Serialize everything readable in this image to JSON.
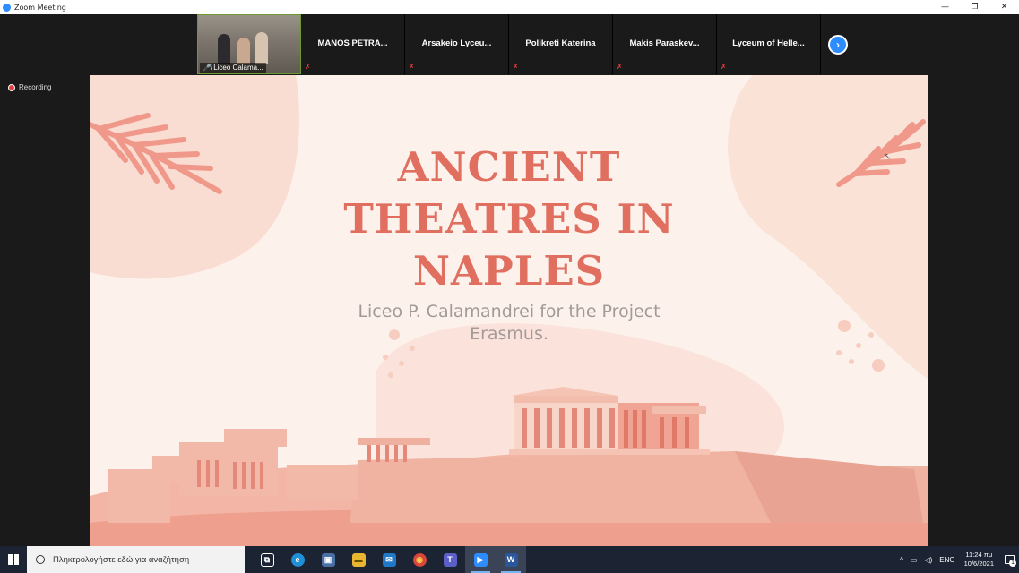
{
  "window": {
    "title": "Zoom Meeting",
    "controls": {
      "minimize": "—",
      "restore": "❐",
      "close": "✕"
    }
  },
  "participants": [
    {
      "name": "Liceo Calama...",
      "video": true,
      "muted": true
    },
    {
      "name": "MANOS  PETRA...",
      "video": false,
      "muted": true
    },
    {
      "name": "Arsakeio  Lyceu...",
      "video": false,
      "muted": true
    },
    {
      "name": "Polikreti Katerina",
      "video": false,
      "muted": true
    },
    {
      "name": "Makis  Paraskev...",
      "video": false,
      "muted": true
    },
    {
      "name": "Lyceum  of  Helle...",
      "video": false,
      "muted": true
    }
  ],
  "next_page_icon": "chevron-right-icon",
  "recording": {
    "label": "Recording"
  },
  "slide": {
    "title_lines": [
      "ANCIENT",
      "THEATRES IN",
      "NAPLES"
    ],
    "subtitle_lines": [
      "Liceo P. Calamandrei for the Project",
      "Erasmus."
    ],
    "colors": {
      "background": "#fdf1ec",
      "title": "#e06f60",
      "subtitle": "#a29a98",
      "accent": "#f0a08e"
    }
  },
  "taskbar": {
    "search_placeholder": "Πληκτρολογήστε εδώ για αναζήτηση",
    "apps": [
      {
        "icon": "task-view-icon",
        "label": "⧉",
        "color": "transparent"
      },
      {
        "icon": "edge-icon",
        "label": "e",
        "color": "#1f8fd6"
      },
      {
        "icon": "store-icon",
        "label": "▣",
        "color": "#4a6fa5"
      },
      {
        "icon": "file-explorer-icon",
        "label": "▬",
        "color": "#e8b630"
      },
      {
        "icon": "mail-icon",
        "label": "✉",
        "color": "#1f78c8"
      },
      {
        "icon": "chrome-icon",
        "label": "◉",
        "color": "#d9463b"
      },
      {
        "icon": "teams-icon",
        "label": "T",
        "color": "#5b5fc7"
      },
      {
        "icon": "zoom-icon",
        "label": "▶",
        "color": "#2d8cff"
      },
      {
        "icon": "word-icon",
        "label": "W",
        "color": "#2b579a"
      }
    ],
    "tray": {
      "chevron": "^",
      "language": "ENG",
      "time": "11:24 πμ",
      "date": "10/6/2021",
      "notification_count": "1"
    }
  }
}
